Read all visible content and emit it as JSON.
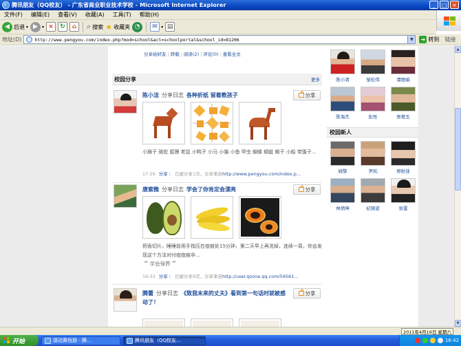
{
  "window": {
    "title": "腾讯朋友（QQ校友） - 广东省商业职业技术学校 - Microsoft Internet Explorer"
  },
  "menu": [
    "文件(F)",
    "编辑(E)",
    "查看(V)",
    "收藏(A)",
    "工具(T)",
    "帮助(H)"
  ],
  "toolbar": {
    "back": "后退",
    "search": "搜索",
    "favorites": "收藏夹"
  },
  "address": {
    "label": "地址(D)",
    "url": "http://www.pengyou.com/index.php?mod=school&act=schoolportal&school_id=81206",
    "go": "转到",
    "links": "链接"
  },
  "prev_actions": {
    "share": "分享给好友",
    "forward": "转载",
    "read": "阅读(2)",
    "comment": "评论(0)",
    "view_full": "查看全文"
  },
  "section": {
    "title": "校园分享",
    "more": "更多"
  },
  "share_label": "分享",
  "posts": [
    {
      "name": "陈小洁",
      "type": "分享日志",
      "title": "各种折纸 留着教孩子",
      "body": "小猴子 骆驼 狐狸 老鼠 小鸭子 小马 小猫 小鱼 甲虫 蝴蝶 蜻蜓 蝎子 小船 带篷子...",
      "time": "17:29",
      "action": "分享",
      "source_note": "已被分享1次，分享来自",
      "source_link": "http://www.pengyou.com/index.p..."
    },
    {
      "name": "唐索微",
      "type": "分享日志",
      "title": "学会了你肯定会漂亮",
      "body": "把香切片，睡睡前用手指压在痘痕处15分钟，第二天早上再洗掉，连续一周，你会发现这个方法对付痘痘痕非...",
      "quote": "学会保养",
      "time": "16:33",
      "action": "分享",
      "source_note": "已被分享9次，分享来自",
      "source_link": "http://user.qzone.qq.com/59561..."
    },
    {
      "name": "腾蕾",
      "type": "分享日志",
      "title": "《致我未来的丈夫》看到第一句话时就被感动了！"
    }
  ],
  "sidebar": {
    "top_friends": [
      "陈小清",
      "邹伦伟",
      "谭丽娟",
      "陈海杰",
      "彭彤",
      "吴艳玉"
    ],
    "new_title": "校园新人",
    "new_friends": [
      "姚黎",
      "尹凯",
      "郑秋佳",
      "林炳坤",
      "纪锦波",
      "张雷"
    ]
  },
  "taskbar": {
    "start": "开始",
    "tasks": [
      "感动黄恒朋 - 腾...",
      "腾讯朋友（QQ校友..."
    ],
    "clock": "16:42",
    "date_tip": "2011年4月16日 星期六"
  }
}
